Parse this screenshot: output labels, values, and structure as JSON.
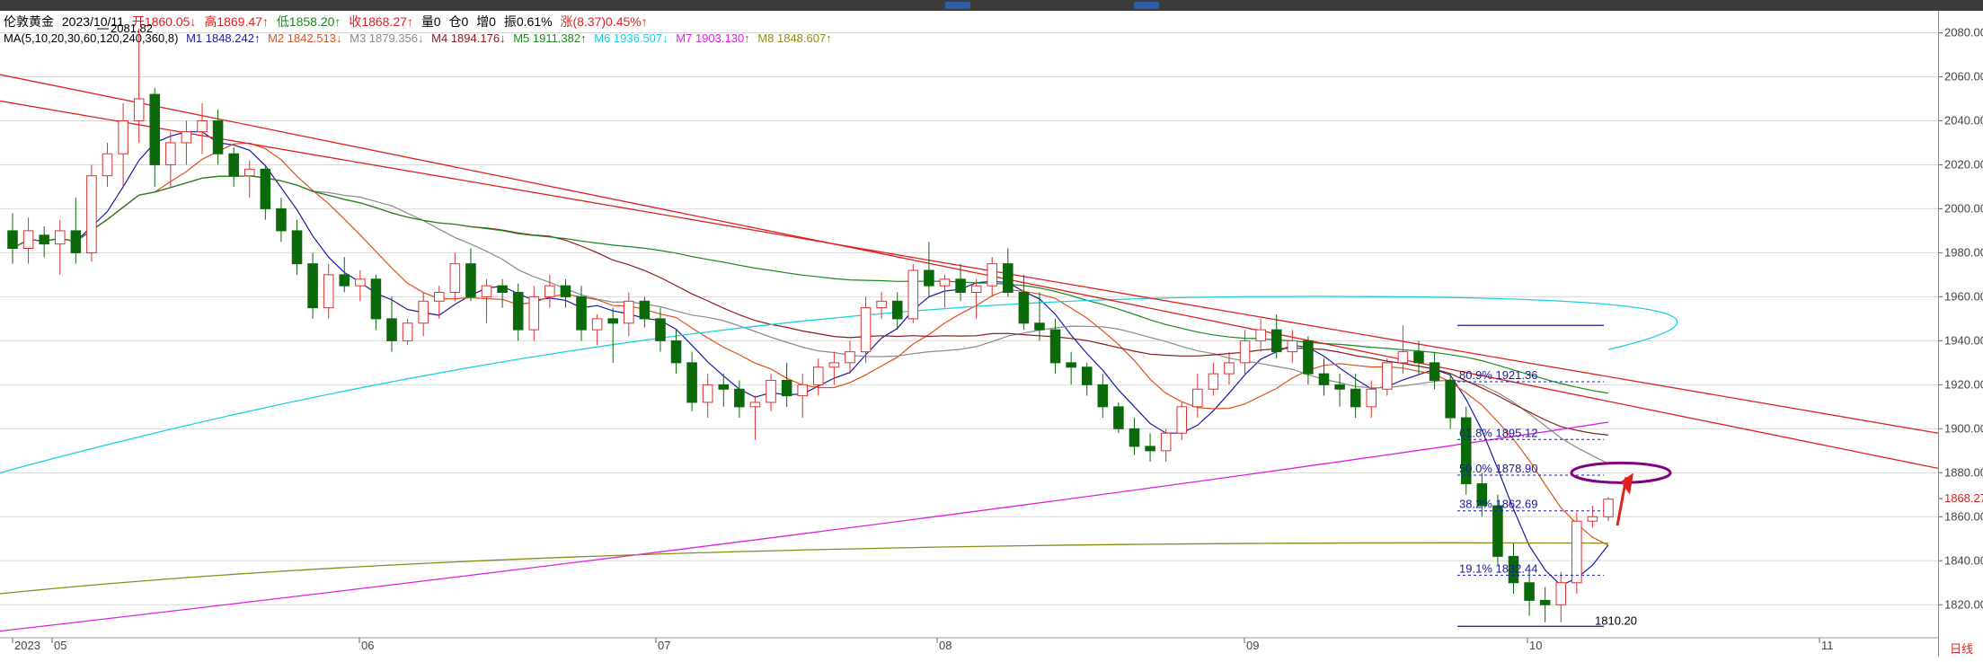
{
  "header": {
    "instrument": "伦敦黄金",
    "date": "2023/10/11",
    "open": "开1860.05↓",
    "high": "高1869.47↑",
    "low": "低1858.20↑",
    "close": "收1868.27↑",
    "volume": "量0",
    "position": "仓0",
    "inc": "增0",
    "amplitude": "振0.61%",
    "change": "涨(8.37)0.45%↑"
  },
  "ma_legend": {
    "label": "MA(5,10,20,30,60,120,240,360,8)",
    "items": [
      {
        "text": "M1 1848.242↑",
        "color": "#1a1aa0"
      },
      {
        "text": "M2 1842.513↓",
        "color": "#e0501a"
      },
      {
        "text": "M3 1879.356↓",
        "color": "#8a8a8a"
      },
      {
        "text": "M4 1894.176↓",
        "color": "#8b1a1a"
      },
      {
        "text": "M5 1911.382↑",
        "color": "#1a8a1a"
      },
      {
        "text": "M6 1936.507↓",
        "color": "#1ad0e0"
      },
      {
        "text": "M7 1903.130↑",
        "color": "#e020e0"
      },
      {
        "text": "M8 1848.607↑",
        "color": "#8a8a1a"
      }
    ]
  },
  "colors": {
    "up": "#e03030",
    "down": "#0a6a0a",
    "grid": "#d8d8d8",
    "trendline": "#e02020",
    "fib": "#1a1aa0",
    "ellipse": "#800080",
    "arrow": "#e02020",
    "price_tag": "#e02020"
  },
  "labels": {
    "high_marker": "2081.82",
    "low_marker": "1810.20",
    "current_price": "1868.27",
    "period": "日线"
  },
  "chart_data": {
    "type": "candlestick",
    "ylim": [
      1805,
      2090
    ],
    "y_ticks": [
      1820,
      1840,
      1860,
      1880,
      1900,
      1920,
      1940,
      1960,
      1980,
      2000,
      2020,
      2040,
      2060,
      2080
    ],
    "x_ticks": [
      "2023",
      "05",
      "06",
      "07",
      "08",
      "09",
      "10",
      "11"
    ],
    "candles": [
      [
        1990,
        1998,
        1975,
        1982
      ],
      [
        1982,
        1996,
        1975,
        1990
      ],
      [
        1988,
        1992,
        1978,
        1984
      ],
      [
        1984,
        1995,
        1970,
        1990
      ],
      [
        1990,
        2005,
        1975,
        1980
      ],
      [
        1980,
        2020,
        1976,
        2015
      ],
      [
        2015,
        2030,
        2010,
        2025
      ],
      [
        2025,
        2048,
        2010,
        2040
      ],
      [
        2040,
        2082,
        2030,
        2050
      ],
      [
        2052,
        2055,
        2010,
        2020
      ],
      [
        2020,
        2035,
        2010,
        2030
      ],
      [
        2030,
        2040,
        2020,
        2035
      ],
      [
        2035,
        2048,
        2025,
        2040
      ],
      [
        2040,
        2045,
        2020,
        2025
      ],
      [
        2025,
        2028,
        2010,
        2015
      ],
      [
        2015,
        2022,
        2005,
        2018
      ],
      [
        2018,
        2020,
        1995,
        2000
      ],
      [
        2000,
        2005,
        1985,
        1990
      ],
      [
        1990,
        1995,
        1970,
        1975
      ],
      [
        1975,
        1980,
        1950,
        1955
      ],
      [
        1955,
        1975,
        1950,
        1970
      ],
      [
        1970,
        1978,
        1962,
        1965
      ],
      [
        1965,
        1972,
        1958,
        1968
      ],
      [
        1968,
        1970,
        1945,
        1950
      ],
      [
        1950,
        1960,
        1935,
        1940
      ],
      [
        1940,
        1950,
        1938,
        1948
      ],
      [
        1948,
        1962,
        1942,
        1958
      ],
      [
        1958,
        1965,
        1950,
        1962
      ],
      [
        1962,
        1980,
        1958,
        1975
      ],
      [
        1975,
        1982,
        1958,
        1960
      ],
      [
        1960,
        1968,
        1948,
        1965
      ],
      [
        1965,
        1968,
        1955,
        1962
      ],
      [
        1962,
        1966,
        1940,
        1945
      ],
      [
        1945,
        1965,
        1940,
        1960
      ],
      [
        1960,
        1970,
        1955,
        1965
      ],
      [
        1965,
        1968,
        1955,
        1960
      ],
      [
        1960,
        1965,
        1940,
        1945
      ],
      [
        1945,
        1952,
        1938,
        1950
      ],
      [
        1950,
        1955,
        1930,
        1948
      ],
      [
        1948,
        1962,
        1942,
        1958
      ],
      [
        1958,
        1960,
        1946,
        1950
      ],
      [
        1950,
        1955,
        1935,
        1940
      ],
      [
        1940,
        1945,
        1925,
        1930
      ],
      [
        1930,
        1935,
        1908,
        1912
      ],
      [
        1912,
        1925,
        1905,
        1920
      ],
      [
        1920,
        1925,
        1910,
        1918
      ],
      [
        1918,
        1922,
        1905,
        1910
      ],
      [
        1910,
        1915,
        1895,
        1912
      ],
      [
        1912,
        1925,
        1908,
        1922
      ],
      [
        1922,
        1930,
        1910,
        1915
      ],
      [
        1915,
        1925,
        1905,
        1920
      ],
      [
        1920,
        1932,
        1915,
        1928
      ],
      [
        1928,
        1935,
        1920,
        1930
      ],
      [
        1930,
        1940,
        1925,
        1935
      ],
      [
        1935,
        1960,
        1930,
        1955
      ],
      [
        1955,
        1962,
        1950,
        1958
      ],
      [
        1958,
        1962,
        1945,
        1950
      ],
      [
        1950,
        1975,
        1948,
        1972
      ],
      [
        1972,
        1985,
        1960,
        1965
      ],
      [
        1965,
        1970,
        1955,
        1968
      ],
      [
        1968,
        1975,
        1958,
        1962
      ],
      [
        1962,
        1968,
        1950,
        1965
      ],
      [
        1965,
        1978,
        1960,
        1975
      ],
      [
        1975,
        1982,
        1960,
        1962
      ],
      [
        1962,
        1970,
        1945,
        1948
      ],
      [
        1948,
        1962,
        1940,
        1945
      ],
      [
        1945,
        1950,
        1925,
        1930
      ],
      [
        1930,
        1935,
        1920,
        1928
      ],
      [
        1928,
        1930,
        1915,
        1920
      ],
      [
        1920,
        1925,
        1905,
        1910
      ],
      [
        1910,
        1912,
        1898,
        1900
      ],
      [
        1900,
        1905,
        1888,
        1892
      ],
      [
        1892,
        1898,
        1885,
        1890
      ],
      [
        1890,
        1900,
        1885,
        1898
      ],
      [
        1898,
        1912,
        1895,
        1910
      ],
      [
        1910,
        1925,
        1905,
        1918
      ],
      [
        1918,
        1930,
        1915,
        1925
      ],
      [
        1925,
        1935,
        1920,
        1930
      ],
      [
        1930,
        1945,
        1925,
        1940
      ],
      [
        1940,
        1950,
        1935,
        1945
      ],
      [
        1945,
        1952,
        1932,
        1935
      ],
      [
        1935,
        1945,
        1930,
        1940
      ],
      [
        1940,
        1942,
        1920,
        1925
      ],
      [
        1925,
        1932,
        1915,
        1920
      ],
      [
        1920,
        1925,
        1910,
        1918
      ],
      [
        1918,
        1925,
        1905,
        1910
      ],
      [
        1910,
        1922,
        1905,
        1918
      ],
      [
        1918,
        1932,
        1915,
        1930
      ],
      [
        1930,
        1947,
        1925,
        1935
      ],
      [
        1935,
        1940,
        1925,
        1930
      ],
      [
        1930,
        1935,
        1918,
        1922
      ],
      [
        1922,
        1925,
        1900,
        1905
      ],
      [
        1905,
        1910,
        1870,
        1875
      ],
      [
        1875,
        1880,
        1860,
        1865
      ],
      [
        1865,
        1870,
        1838,
        1842
      ],
      [
        1842,
        1848,
        1825,
        1830
      ],
      [
        1830,
        1835,
        1815,
        1822
      ],
      [
        1822,
        1828,
        1812,
        1820
      ],
      [
        1820,
        1835,
        1812,
        1830
      ],
      [
        1830,
        1862,
        1825,
        1858
      ],
      [
        1858,
        1865,
        1855,
        1860
      ],
      [
        1860,
        1869,
        1858,
        1868
      ]
    ],
    "fib_levels": [
      {
        "label": "19.1% 1832.44",
        "value": 1833.44
      },
      {
        "label": "38.2% 1862.69",
        "value": 1862.69
      },
      {
        "label": "50.0% 1878.90",
        "value": 1878.9
      },
      {
        "label": "61.8% 1895.12",
        "value": 1895.12
      },
      {
        "label": "80.9% 1921.36",
        "value": 1921.36
      }
    ],
    "fib_range_lines": [
      1810.2,
      1947.0
    ]
  }
}
